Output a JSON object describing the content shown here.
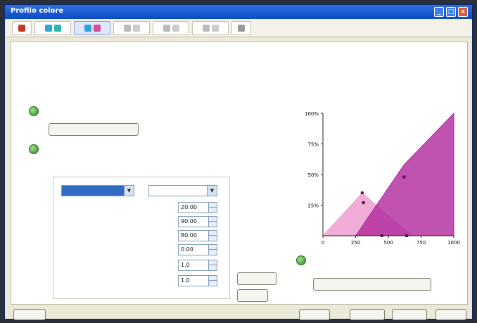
{
  "window": {
    "title": "Profilo colore",
    "minimize": "_",
    "maximize": "□",
    "close": "×"
  },
  "toolbar": {
    "icons": [
      "printer-icon",
      "ink-flow-icon",
      "separation-icon",
      "curve-icon",
      "gradation-icon",
      "ink-limit-icon",
      "profile-icon"
    ]
  },
  "main": {
    "heading": "",
    "description": "",
    "step1_text": "",
    "step1_button": "",
    "step2_text": "",
    "group_title": "",
    "select_left": "",
    "select_right": "",
    "fields": [
      {
        "label": "",
        "value": "20.00"
      },
      {
        "label": "",
        "value": "90.00"
      },
      {
        "label": "",
        "value": "80.00"
      },
      {
        "label": "",
        "value": "0.00"
      },
      {
        "label": "",
        "value": "1.0"
      },
      {
        "label": "",
        "value": "1.0"
      }
    ],
    "btn_apply": "",
    "btn_cancel": "",
    "step3_text": "",
    "step3_button": ""
  },
  "footer": {
    "left": "",
    "b1": "",
    "b2": "",
    "b3": "",
    "b4": ""
  },
  "chart_data": {
    "type": "area",
    "ylabel": "",
    "xlabel": "",
    "x_ticks": [
      "0",
      "250",
      "500",
      "750",
      "1000"
    ],
    "y_ticks": [
      "25%",
      "50%",
      "75%",
      "100%"
    ],
    "xlim": [
      0,
      1000
    ],
    "ylim": [
      0,
      100
    ],
    "colors": {
      "light": "#f1a8d6",
      "dark": "#b0289c"
    },
    "series": [
      {
        "points": [
          [
            0,
            0
          ],
          [
            300,
            35
          ],
          [
            680,
            0
          ]
        ]
      },
      {
        "points": [
          [
            250,
            0
          ],
          [
            620,
            58
          ],
          [
            1000,
            100
          ],
          [
            1000,
            0
          ]
        ]
      }
    ],
    "handles": [
      [
        300,
        35
      ],
      [
        310,
        27
      ],
      [
        620,
        48
      ],
      [
        450,
        0
      ],
      [
        640,
        0
      ]
    ]
  }
}
